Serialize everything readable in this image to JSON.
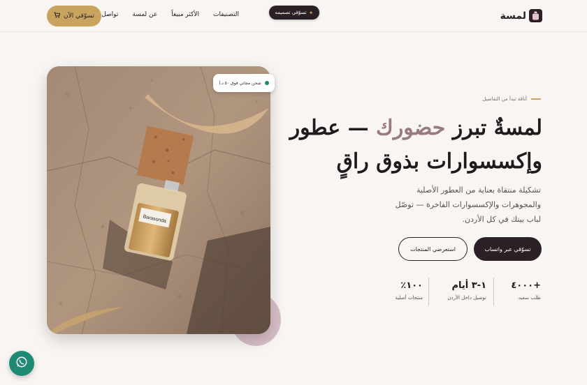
{
  "header": {
    "logo_text": "لمسة",
    "design_pill": "تسوّقي تصميمه",
    "nav": [
      "التصنيفات",
      "الأكثر مبيعاً",
      "عن لمسة",
      "تواصل"
    ],
    "shop_btn": "تسوّقي الآن"
  },
  "hero": {
    "eyebrow": "أناقة تبدأ من التفاصيل",
    "title_part1": "لمسةٌ تبرز ",
    "title_highlight": "حضورك",
    "title_part2": " — عطور وإكسسوارات بذوق راقٍ",
    "description": "تشكيلة منتقاة بعناية من العطور الأصلية والمجوهرات والإكسسوارات الفاخرة — توصّل لباب بيتك في كل الأردن.",
    "primary_btn": "تسوّقي عبر واتساب",
    "outline_btn": "استعرضي المنتجات"
  },
  "stats": [
    {
      "num": "+٤٠٠٠",
      "label": "طلب سعيد"
    },
    {
      "num": "١-٣ أيام",
      "label": "توصيل داخل الأردن"
    },
    {
      "num": "١٠٠٪",
      "label": "منتجات أصلية"
    }
  ],
  "badge": {
    "text": "شحن مجاني فوق ٥٠ د.أ"
  },
  "bottle_label": "Barasonda",
  "colors": {
    "accent_gold": "#c9a45f",
    "dark": "#2b2026",
    "highlight": "#9a7a82",
    "whatsapp": "#1f8a73"
  }
}
